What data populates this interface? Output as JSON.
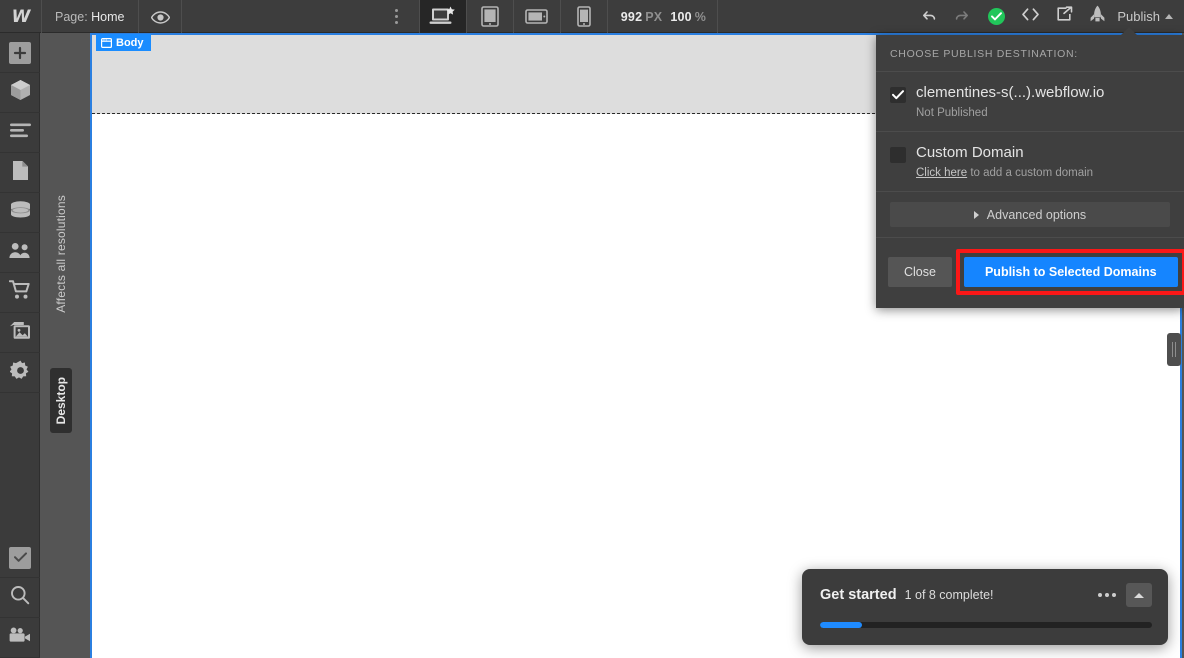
{
  "topbar": {
    "logo": "W",
    "page_prefix": "Page:",
    "page_name": "Home",
    "preview_icon": "eye-icon",
    "kebab_icon": "more-options-icon",
    "devices": [
      {
        "name": "desktop",
        "icon": "desktop-star-icon",
        "active": true
      },
      {
        "name": "tablet",
        "icon": "tablet-icon",
        "active": false
      },
      {
        "name": "mobile-landscape",
        "icon": "mobile-landscape-icon",
        "active": false
      },
      {
        "name": "mobile-portrait",
        "icon": "mobile-portrait-icon",
        "active": false
      }
    ],
    "canvas_width": "992",
    "canvas_width_unit": "PX",
    "zoom_level": "100",
    "zoom_unit": "%",
    "undo_icon": "undo-icon",
    "redo_icon": "redo-icon",
    "status_icon": "save-status-check-icon",
    "code_icon": "code-brackets-icon",
    "export_icon": "export-share-icon",
    "rocket_icon": "rocket-icon",
    "publish_label": "Publish",
    "publish_chevron_icon": "chevron-up-icon"
  },
  "sidebar": {
    "items": [
      {
        "name": "add-elements",
        "icon": "plus-icon"
      },
      {
        "name": "components",
        "icon": "cube-icon"
      },
      {
        "name": "navigator",
        "icon": "lines-icon"
      },
      {
        "name": "pages",
        "icon": "page-document-icon"
      },
      {
        "name": "cms-collections",
        "icon": "database-icon"
      },
      {
        "name": "users",
        "icon": "people-icon"
      },
      {
        "name": "ecommerce",
        "icon": "shopping-cart-icon"
      },
      {
        "name": "assets",
        "icon": "images-icon"
      },
      {
        "name": "settings",
        "icon": "gear-icon"
      }
    ],
    "bottom_items": [
      {
        "name": "audit",
        "icon": "checkbox-check-icon"
      },
      {
        "name": "search",
        "icon": "magnifier-icon"
      },
      {
        "name": "video-tutorials",
        "icon": "video-camera-icon"
      }
    ]
  },
  "canvas": {
    "breakpoint_note": "Affects all resolutions",
    "breakpoint_name": "Desktop",
    "body_label": "Body",
    "body_icon": "window-element-icon",
    "resize_handle_icon": "resize-grip-icon",
    "selection_color": "#2b7fe0",
    "header_block_color": "#dddddd"
  },
  "publish_panel": {
    "heading": "CHOOSE PUBLISH DESTINATION:",
    "destinations": [
      {
        "name": "webflow-subdomain",
        "domain": "clementines-s(...).webflow.io",
        "status": "Not Published",
        "checked": true,
        "check_icon": "checkmark-icon"
      },
      {
        "name": "custom-domain",
        "domain": "Custom Domain",
        "link_text": "Click here",
        "status_suffix": " to add a custom domain",
        "checked": false
      }
    ],
    "advanced_label": "Advanced options",
    "advanced_icon": "triangle-right-icon",
    "close_label": "Close",
    "publish_label": "Publish to Selected Domains",
    "highlight_color": "#fb1717",
    "publish_button_color": "#1585ff"
  },
  "get_started": {
    "title": "Get started",
    "progress_text": "1 of 8 complete!",
    "more_icon": "ellipsis-icon",
    "collapse_icon": "chevron-up-icon",
    "progress_percent": 12.5,
    "progress_color": "#1f8bff"
  }
}
